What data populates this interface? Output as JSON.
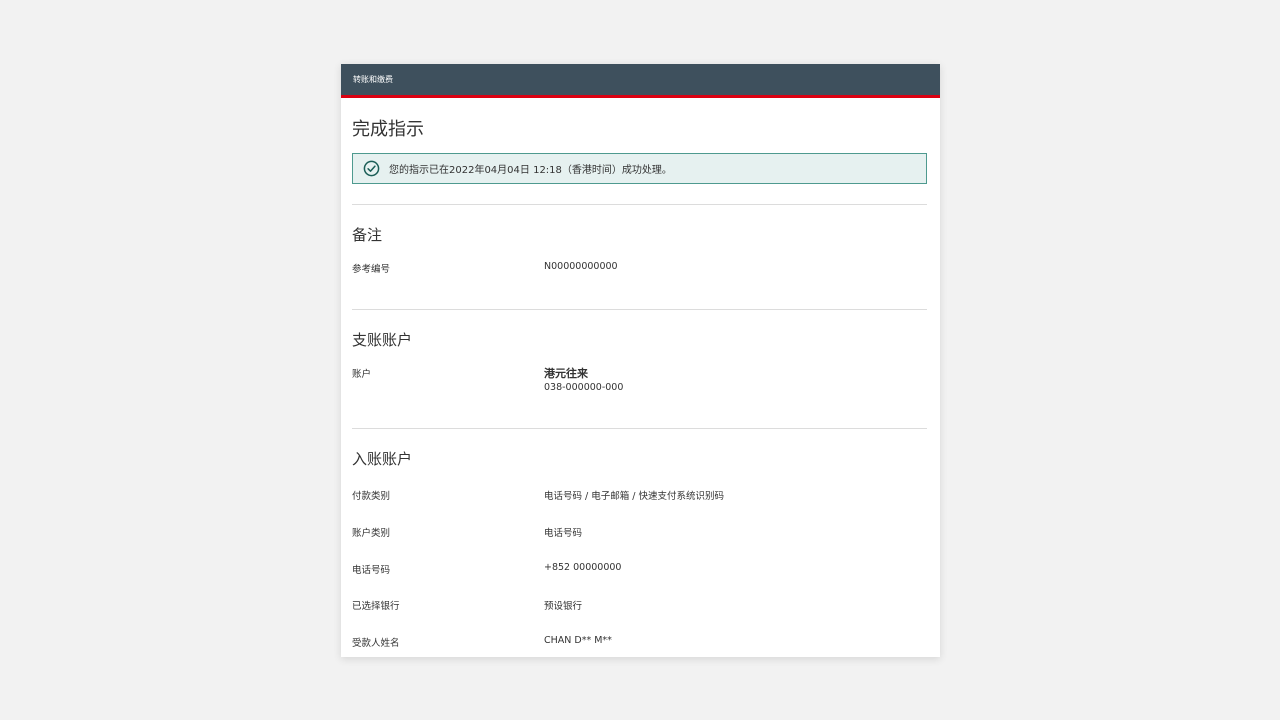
{
  "header": {
    "title": "转账和缴费"
  },
  "page": {
    "title": "完成指示"
  },
  "notice": {
    "icon": "check-circle-icon",
    "text": "您的指示已在2022年04月04日 12:18（香港时间）成功处理。",
    "color": "#1b5e57"
  },
  "sections": {
    "remarks": {
      "title": "备注",
      "reference_label": "参考编号",
      "reference_value": "N00000000000"
    },
    "debit": {
      "title": "支账账户",
      "account_label": "账户",
      "account_name": "港元往来",
      "account_number": "038-000000-000"
    },
    "credit": {
      "title": "入账账户",
      "rows": [
        {
          "label": "付款类别",
          "value": "电话号码 / 电子邮箱 / 快速支付系统识别码"
        },
        {
          "label": "账户类别",
          "value": "电话号码"
        },
        {
          "label": "电话号码",
          "value": "+852 00000000"
        },
        {
          "label": "已选择银行",
          "value": "预设银行"
        },
        {
          "label": "受款人姓名",
          "value": "CHAN D** M**"
        }
      ]
    }
  },
  "colors": {
    "header_bg": "#3e505d",
    "accent_red": "#db0011",
    "notice_border": "#4e9a8f",
    "notice_bg": "#e6f1f0"
  }
}
